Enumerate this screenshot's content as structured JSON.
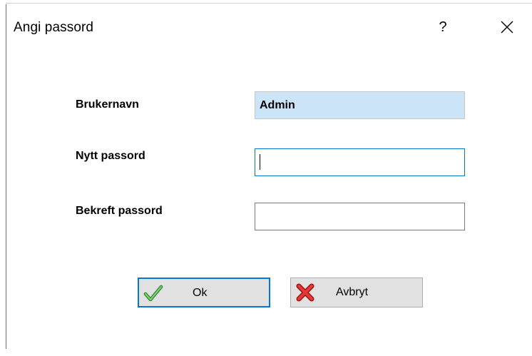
{
  "dialog": {
    "title": "Angi passord",
    "help_label": "?",
    "close_icon": "close-icon"
  },
  "form": {
    "username_label": "Brukernavn",
    "username_value": "Admin",
    "new_password_label": "Nytt passord",
    "new_password_value": "",
    "confirm_password_label": "Bekreft passord",
    "confirm_password_value": ""
  },
  "buttons": {
    "ok_label": "Ok",
    "ok_icon": "checkmark-icon",
    "cancel_label": "Avbryt",
    "cancel_icon": "red-x-icon"
  },
  "colors": {
    "accent": "#0078d7",
    "username_field_bg": "#cce4f7",
    "button_bg": "#e1e1e1"
  }
}
